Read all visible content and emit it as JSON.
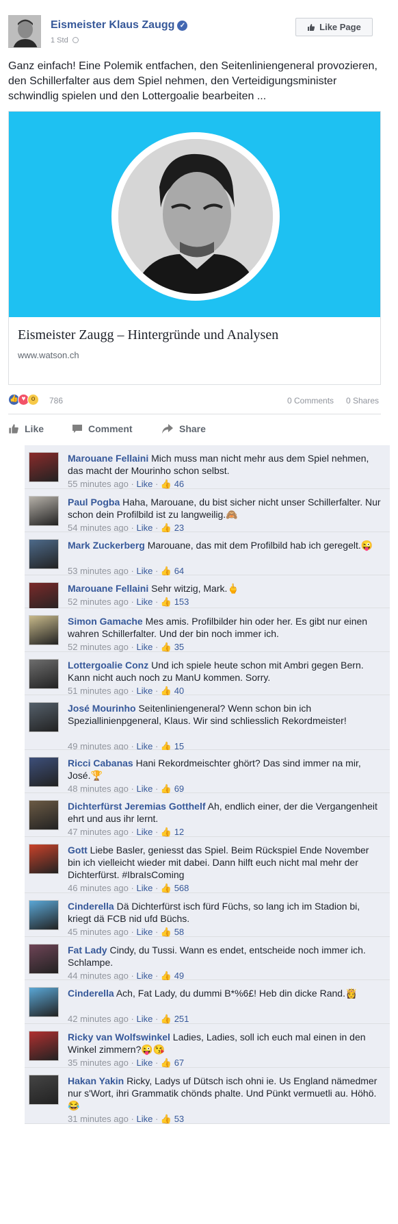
{
  "post": {
    "page_name": "Eismeister Klaus Zaugg",
    "verified": true,
    "timestamp": "1 Std",
    "like_page_label": "Like Page",
    "text": "Ganz einfach! Eine Polemik entfachen, den Seitenliniengeneral provozieren, den Schillerfalter aus dem Spiel nehmen, den Verteidigungsminister schwindlig spielen und den Lottergoalie bearbeiten ..."
  },
  "link_card": {
    "title": "Eismeister Zaugg – Hintergründe und Analysen",
    "domain": "www.watson.ch",
    "image_background": "#1ec1f2"
  },
  "reactions": {
    "count": "786",
    "comments": "0 Comments",
    "shares": "0 Shares",
    "icons": [
      "like-icon",
      "love-icon",
      "wow-icon"
    ]
  },
  "actions": {
    "like": "Like",
    "comment": "Comment",
    "share": "Share"
  },
  "comments": [
    {
      "name": "Marouane Fellaini",
      "text": "Mich muss man nicht mehr aus dem Spiel nehmen, das macht der Mourinho schon selbst.",
      "time": "55 minutes ago",
      "like_label": "Like",
      "likes": "46",
      "emoji": ""
    },
    {
      "name": "Paul Pogba",
      "text": "Haha, Marouane, du bist sicher nicht unser Schillerfalter. Nur schon dein Profilbild ist zu langweilig.",
      "time": "54 minutes ago",
      "like_label": "Like",
      "likes": "23",
      "emoji": "🙈"
    },
    {
      "name": "Mark Zuckerberg",
      "text": "Marouane, das mit dem Profilbild hab ich geregelt.",
      "time": "53 minutes ago",
      "like_label": "Like",
      "likes": "64",
      "emoji": "😜"
    },
    {
      "name": "Marouane Fellaini",
      "text": "Sehr witzig, Mark.",
      "time": "52 minutes ago",
      "like_label": "Like",
      "likes": "153",
      "emoji": "🖕"
    },
    {
      "name": "Simon Gamache",
      "text": "Mes amis. Profilbilder hin oder her. Es gibt nur einen wahren Schillerfalter. Und der bin noch immer ich.",
      "time": "52 minutes ago",
      "like_label": "Like",
      "likes": "35",
      "emoji": ""
    },
    {
      "name": "Lottergoalie Conz",
      "text": "Und ich spiele heute schon mit Ambri gegen Bern. Kann nicht auch noch zu ManU kommen. Sorry.",
      "time": "51 minutes ago",
      "like_label": "Like",
      "likes": "40",
      "emoji": ""
    },
    {
      "name": "José Mourinho",
      "text": "Seitenliniengeneral? Wenn schon bin ich Speziallinienpgeneral, Klaus. Wir sind schliesslich Rekordmeister!",
      "time": "49 minutes ago",
      "like_label": "Like",
      "likes": "15",
      "emoji": ""
    },
    {
      "name": "Ricci Cabanas",
      "text": "Hani Rekordmeischter ghört? Das sind immer na mir, José.",
      "time": "48 minutes ago",
      "like_label": "Like",
      "likes": "69",
      "emoji": "🏆"
    },
    {
      "name": "Dichterfürst Jeremias Gotthelf",
      "text": "Ah, endlich einer, der die Vergangenheit ehrt und aus ihr lernt.",
      "time": "47 minutes ago",
      "like_label": "Like",
      "likes": "12",
      "emoji": ""
    },
    {
      "name": "Gott",
      "text": "Liebe Basler, geniesst das Spiel. Beim Rückspiel Ende November bin ich vielleicht wieder mit dabei. Dann hilft euch nicht mal mehr der Dichterfürst. #IbraIsComing",
      "time": "46 minutes ago",
      "like_label": "Like",
      "likes": "568",
      "emoji": ""
    },
    {
      "name": "Cinderella",
      "text": "Dä Dichterfürst isch fürd Füchs, so lang ich im Stadion bi, kriegt dä FCB nid ufd Büchs.",
      "time": "45 minutes ago",
      "like_label": "Like",
      "likes": "58",
      "emoji": ""
    },
    {
      "name": "Fat Lady",
      "text": "Cindy, du Tussi. Wann es endet, entscheide noch immer ich. Schlampe.",
      "time": "44 minutes ago",
      "like_label": "Like",
      "likes": "49",
      "emoji": ""
    },
    {
      "name": "Cinderella",
      "text": "Ach, Fat Lady, du dummi B*%6£! Heb din dicke Rand.",
      "time": "42 minutes ago",
      "like_label": "Like",
      "likes": "251",
      "emoji": "👸"
    },
    {
      "name": "Ricky van Wolfswinkel",
      "text": "Ladies, Ladies, soll ich euch mal einen in den Winkel zimmern?",
      "time": "35 minutes ago",
      "like_label": "Like",
      "likes": "67",
      "emoji": "😜😘"
    },
    {
      "name": "Hakan Yakin",
      "text": "Ricky, Ladys uf Dütsch isch ohni ie. Us England nämedmer nur s'Wort, ihri Grammatik chönds phalte. Und Pünkt vermuetli au. Höhö.",
      "time": "31 minutes ago",
      "like_label": "Like",
      "likes": "53",
      "emoji": "😂"
    }
  ],
  "colors": {
    "link_blue": "#365899",
    "meta_gray": "#90949c",
    "comment_bg": "#eceef4"
  }
}
